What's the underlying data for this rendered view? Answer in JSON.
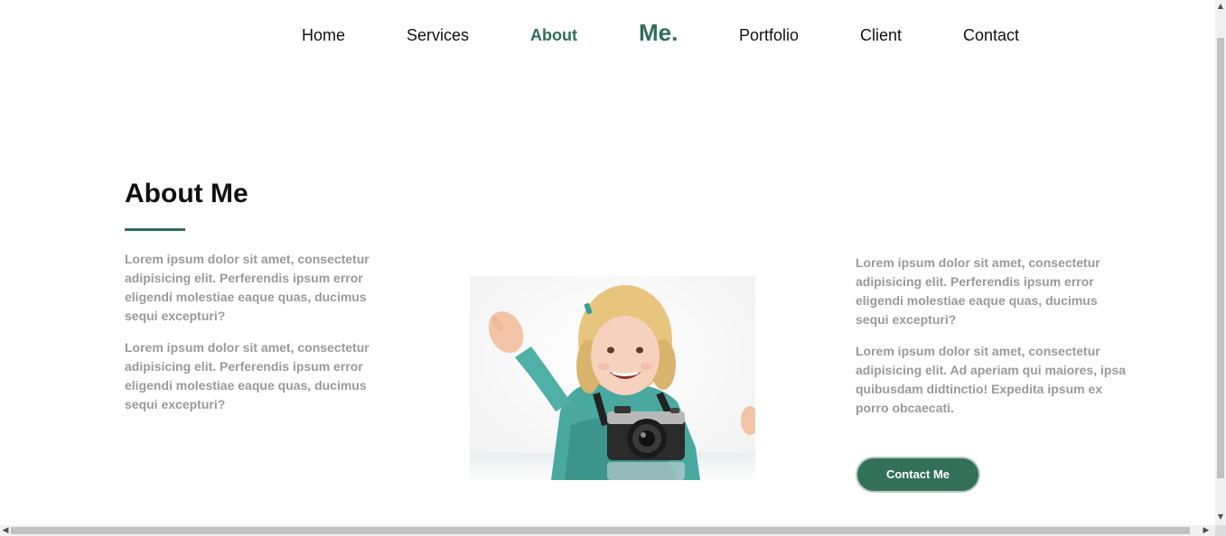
{
  "nav": {
    "home": "Home",
    "services": "Services",
    "about": "About",
    "brand": "Me.",
    "portfolio": "Portfolio",
    "client": "Client",
    "contact": "Contact"
  },
  "about": {
    "title": "About Me",
    "left_paragraphs": [
      "Lorem ipsum dolor sit amet, consectetur adipisicing elit. Perferendis ipsum error eligendi molestiae eaque quas, ducimus sequi excepturi?",
      "Lorem ipsum dolor sit amet, consectetur adipisicing elit. Perferendis ipsum error eligendi molestiae eaque quas, ducimus sequi excepturi?"
    ],
    "right_paragraphs": [
      "Lorem ipsum dolor sit amet, consectetur adipisicing elit. Perferendis ipsum error eligendi molestiae eaque quas, ducimus sequi excepturi?",
      "Lorem ipsum dolor sit amet, consectetur adipisicing elit. Ad aperiam qui maiores, ipsa quibusdam didtinctio! Expedita ipsum ex porro obcaecati."
    ],
    "button_label": "Contact Me",
    "photo_icon": "child-with-camera-photo"
  },
  "colors": {
    "accent": "#2f6f57",
    "button": "#33705a",
    "body_text": "#9a9a9a"
  },
  "scrollbar": {
    "up_icon": "scroll-up-arrow-icon",
    "down_icon": "scroll-down-arrow-icon",
    "left_icon": "scroll-left-arrow-icon",
    "right_icon": "scroll-right-arrow-icon"
  }
}
